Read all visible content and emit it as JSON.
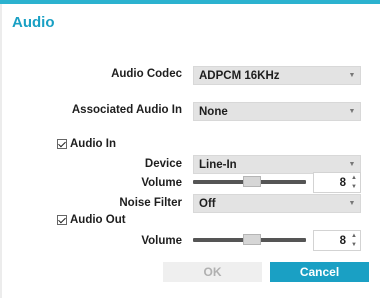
{
  "dialog": {
    "title": "Audio"
  },
  "audio_codec": {
    "label": "Audio Codec",
    "value": "ADPCM 16KHz"
  },
  "associated_audio_in": {
    "label": "Associated Audio In",
    "value": "None"
  },
  "audio_in": {
    "checkbox_label": "Audio In",
    "checked": true,
    "device": {
      "label": "Device",
      "value": "Line-In"
    },
    "volume": {
      "label": "Volume",
      "value": "8",
      "level": 0.53
    },
    "noise_filter": {
      "label": "Noise Filter",
      "value": "Off"
    }
  },
  "audio_out": {
    "checkbox_label": "Audio Out",
    "checked": true,
    "volume": {
      "label": "Volume",
      "value": "8",
      "level": 0.53
    }
  },
  "icons": {
    "dropdown": "chevron-down-icon",
    "spin_up": "arrow-up-icon",
    "spin_down": "arrow-down-icon",
    "check": "checkmark-icon"
  },
  "buttons": {
    "ok": "OK",
    "cancel": "Cancel"
  },
  "colors": {
    "accent": "#1aa0c4",
    "topbar": "#2bb2cf",
    "disabled": "#efefef"
  }
}
